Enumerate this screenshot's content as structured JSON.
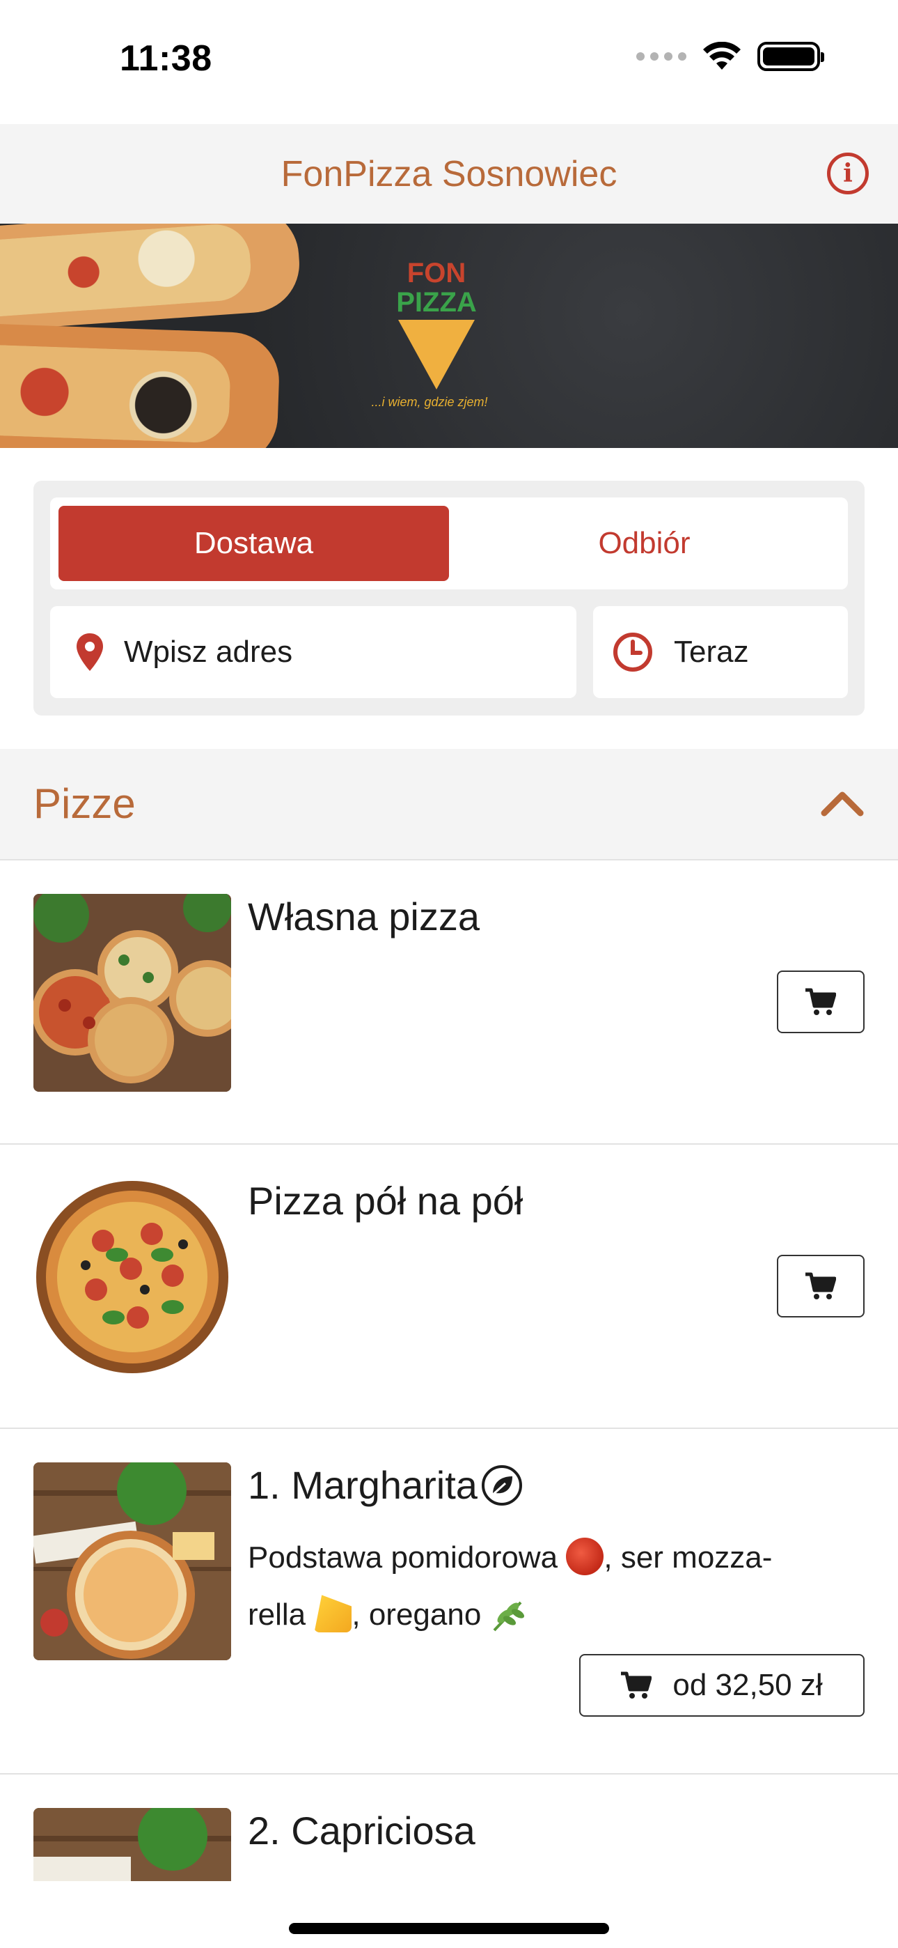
{
  "status_bar": {
    "time": "11:38"
  },
  "header": {
    "title": "FonPizza Sosnowiec",
    "info_icon": "info-icon"
  },
  "banner": {
    "logo_top": "FON",
    "logo_bottom": "PIZZA",
    "logo_tagline": "...i wiem, gdzie zjem!"
  },
  "order": {
    "mode_delivery": "Dostawa",
    "mode_pickup": "Odbiór",
    "active_mode": "Dostawa",
    "address_placeholder": "Wpisz adres",
    "time_value": "Teraz"
  },
  "category": {
    "title": "Pizze",
    "expanded": true
  },
  "items": [
    {
      "name": "Własna pizza",
      "description": "",
      "price_label": ""
    },
    {
      "name": "Pizza pół na pół",
      "description": "",
      "price_label": ""
    },
    {
      "name": "1. Margharita",
      "description_line1": "Podstawa pomidorowa",
      "description_line1b": ", ser mozza-",
      "description_line2": "rella",
      "description_line2b": ", oregano",
      "price_label": "od 32,50 zł",
      "vegetarian": true
    },
    {
      "name": "2. Capriciosa"
    }
  ],
  "colors": {
    "accent": "#c23a2f",
    "brand_brown": "#b86a3a",
    "header_bg": "#f4f4f4"
  }
}
